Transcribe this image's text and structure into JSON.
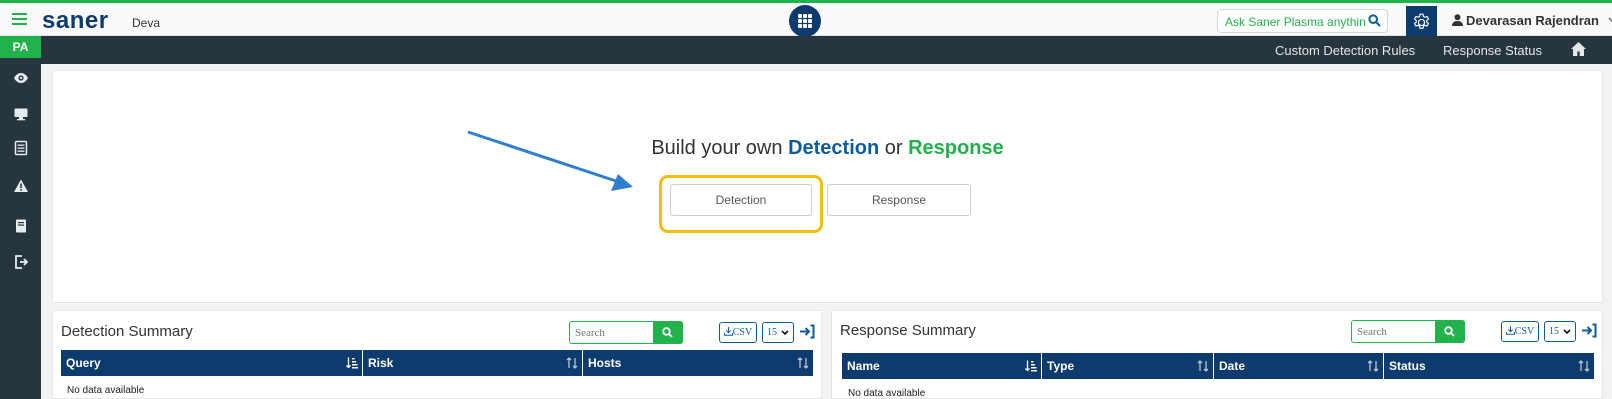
{
  "header": {
    "logo": "saner",
    "org": "Deva",
    "ask_placeholder": "Ask Saner Plasma anything !",
    "user_name": "Devarasan Rajendran"
  },
  "sidebar": {
    "badge": "PA",
    "icons": [
      "eye-icon",
      "monitor-icon",
      "list-icon",
      "warning-icon",
      "book-icon",
      "logout-icon"
    ]
  },
  "subnav": {
    "links": [
      "Custom Detection Rules",
      "Response Status"
    ]
  },
  "hero": {
    "title_prefix": "Build your own ",
    "title_detection": "Detection",
    "title_or": " or ",
    "title_response": "Response",
    "detection_button": "Detection",
    "response_button": "Response"
  },
  "detection_summary": {
    "title": "Detection Summary",
    "search_placeholder": "Search",
    "csv_label": "CSV",
    "page_size": "15",
    "columns": [
      "Query",
      "Risk",
      "Hosts"
    ],
    "empty": "No data available"
  },
  "response_summary": {
    "title": "Response Summary",
    "search_placeholder": "Search",
    "csv_label": "CSV",
    "page_size": "15",
    "columns": [
      "Name",
      "Type",
      "Date",
      "Status"
    ],
    "empty": "No data available"
  },
  "colors": {
    "brand_navy": "#0d3b6e",
    "brand_green": "#22b24c",
    "sidebar_dark": "#27353f",
    "highlight": "#f5bd12",
    "arrow": "#2f7fd0"
  }
}
